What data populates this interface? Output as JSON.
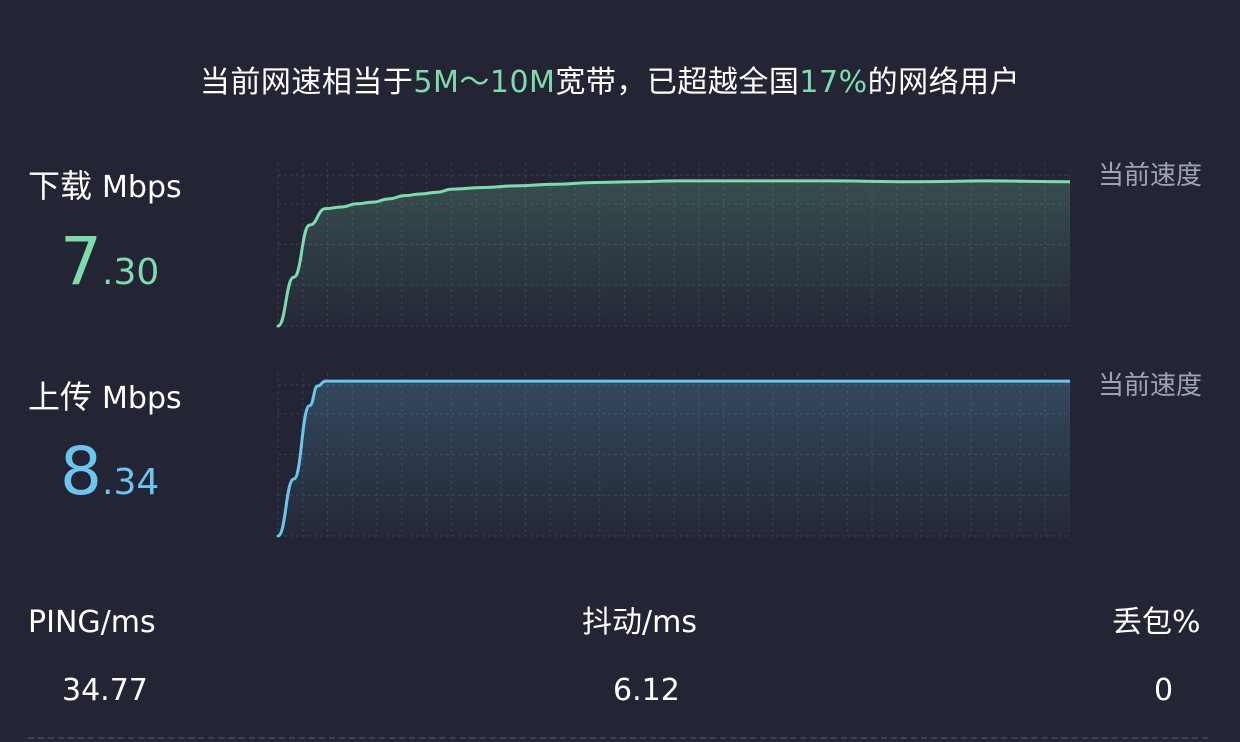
{
  "summary": {
    "prefix": "当前网速相当于",
    "bandwidth": "5M～10M",
    "middle": "宽带，已超越全国",
    "percent": "17%",
    "suffix": "的网络用户"
  },
  "download": {
    "label": "下载",
    "unit": "Mbps",
    "value_int": "7",
    "value_dec": ".30",
    "current_speed_label": "当前速度",
    "color": "#7fdbae"
  },
  "upload": {
    "label": "上传",
    "unit": "Mbps",
    "value_int": "8",
    "value_dec": ".34",
    "current_speed_label": "当前速度",
    "color": "#6cc5ef"
  },
  "stats": {
    "ping_label": "PING/ms",
    "ping_value": "34.77",
    "jitter_label": "抖动/ms",
    "jitter_value": "6.12",
    "loss_label": "丢包%",
    "loss_value": "0"
  },
  "chart_data": [
    {
      "type": "area",
      "color": "#7fdbae",
      "grid": true,
      "x": [
        0,
        2,
        4,
        6,
        8,
        10,
        12,
        14,
        16,
        18,
        20,
        22,
        26,
        30,
        35,
        40,
        45,
        50,
        60,
        70,
        80,
        90,
        100
      ],
      "values": [
        0,
        30,
        62,
        72,
        73,
        75,
        76,
        78,
        80,
        81,
        82,
        84,
        85,
        86,
        87,
        88,
        88.5,
        89,
        89,
        89,
        88.5,
        89,
        88.5
      ],
      "ylim": [
        0,
        100
      ]
    },
    {
      "type": "area",
      "color": "#6cc5ef",
      "grid": true,
      "x": [
        0,
        2,
        4,
        5,
        6,
        8,
        10,
        20,
        30,
        40,
        50,
        60,
        70,
        80,
        90,
        100
      ],
      "values": [
        0,
        35,
        80,
        92,
        95,
        95,
        95,
        95,
        95,
        95,
        95,
        95,
        95,
        95,
        95,
        95
      ],
      "ylim": [
        0,
        100
      ]
    }
  ]
}
